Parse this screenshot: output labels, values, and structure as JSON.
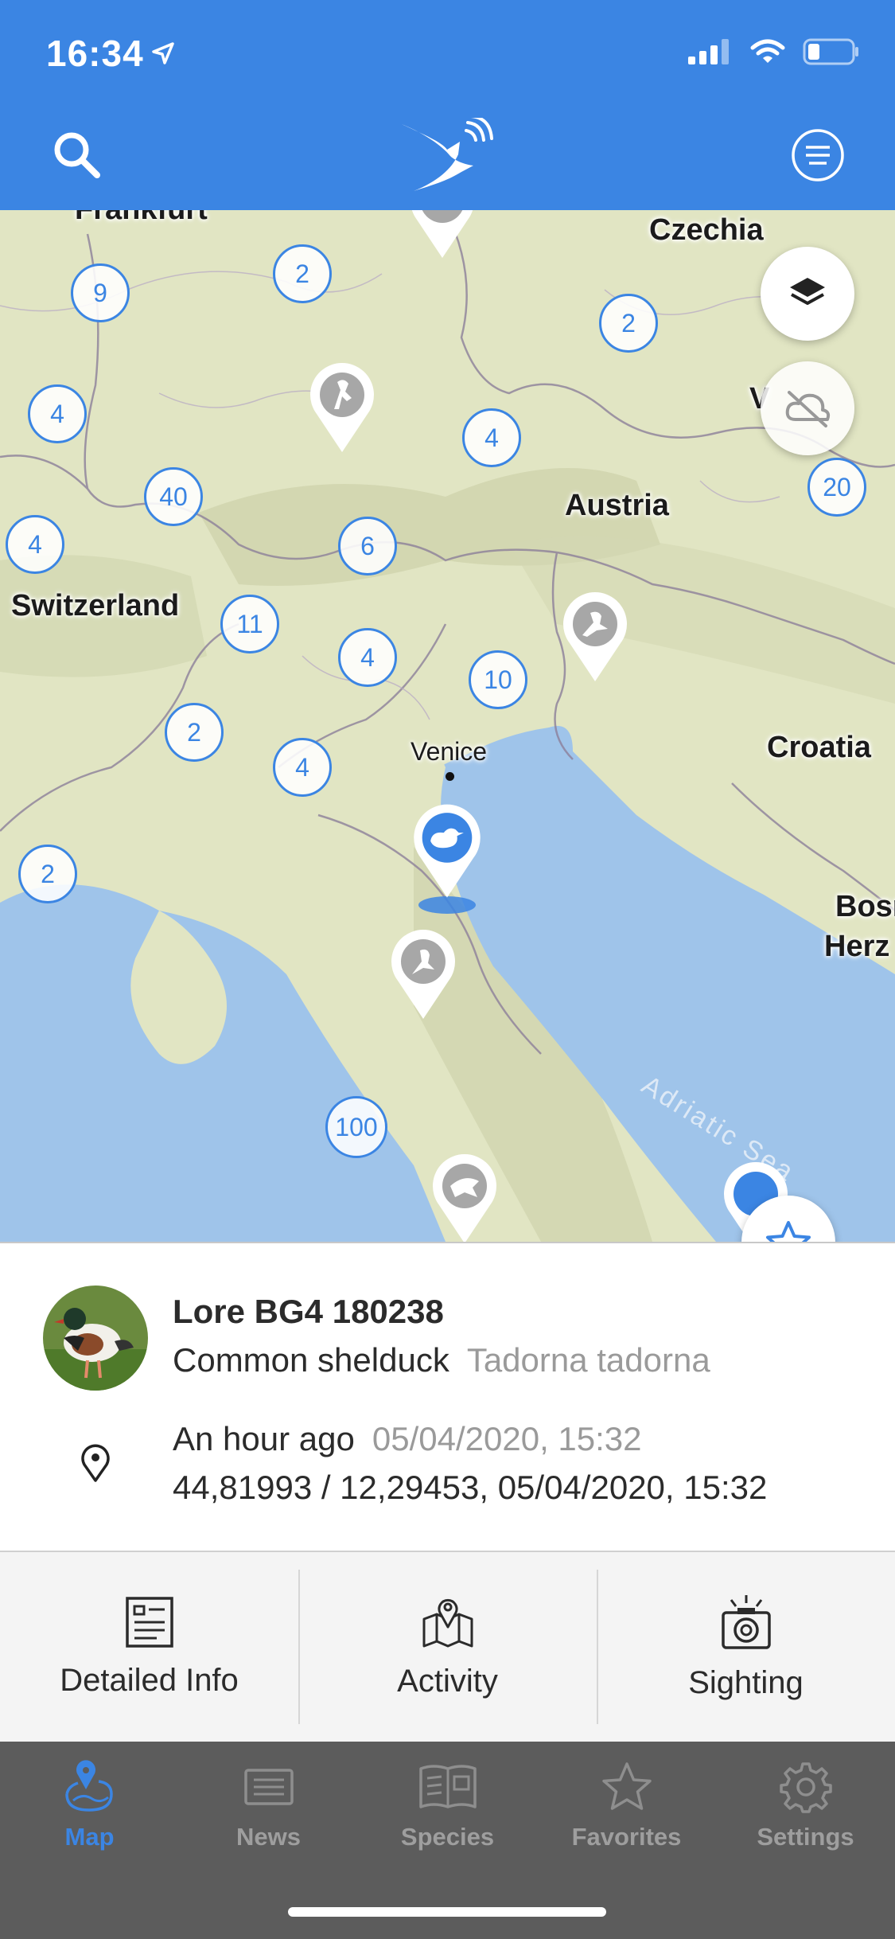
{
  "status": {
    "time": "16:34"
  },
  "colors": {
    "accent": "#3b85e3",
    "water": "#9fc4ea",
    "land": "#e1e5c3",
    "tabbar": "#5c5c5c"
  },
  "header": {
    "search_icon": "search-icon",
    "logo_icon": "stork-logo-icon",
    "filter_icon": "filter-menu-icon"
  },
  "map": {
    "places": [
      "Frankfurt",
      "Czechia",
      "Austria",
      "Switzerland",
      "Venice",
      "Croatia",
      "Bosn",
      "Herz",
      "Adriatic Sea",
      "V"
    ],
    "clusters": [
      "9",
      "2",
      "2",
      "4",
      "4",
      "40",
      "20",
      "4",
      "6",
      "11",
      "4",
      "10",
      "2",
      "4",
      "2",
      "100"
    ]
  },
  "bird": {
    "name": "Lore BG4 180238",
    "common_name": "Common shelduck",
    "latin_name": "Tadorna tadorna",
    "relative_time": "An hour ago",
    "timestamp": "05/04/2020, 15:32",
    "coords": "44,81993 / 12,29453, 05/04/2020, 15:32"
  },
  "actions": [
    {
      "label": "Detailed Info",
      "icon": "document-icon"
    },
    {
      "label": "Activity",
      "icon": "map-pin-icon"
    },
    {
      "label": "Sighting",
      "icon": "camera-icon"
    }
  ],
  "tabs": [
    {
      "label": "Map",
      "icon": "map-icon",
      "active": true
    },
    {
      "label": "News",
      "icon": "news-icon",
      "active": false
    },
    {
      "label": "Species",
      "icon": "book-icon",
      "active": false
    },
    {
      "label": "Favorites",
      "icon": "star-icon",
      "active": false
    },
    {
      "label": "Settings",
      "icon": "gear-icon",
      "active": false
    }
  ]
}
